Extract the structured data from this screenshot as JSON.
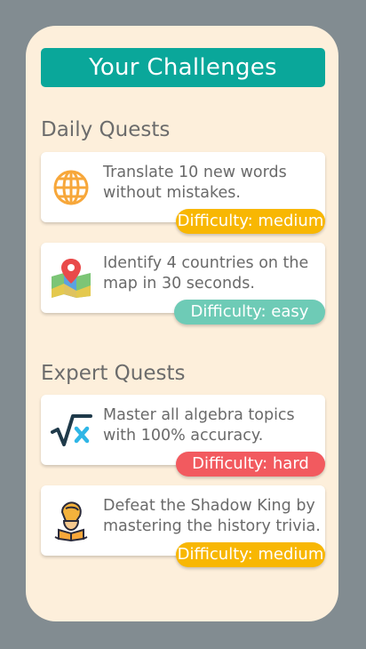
{
  "header": {
    "title": "Your Challenges"
  },
  "sections": {
    "daily": {
      "title": "Daily Quests",
      "quests": [
        {
          "text": "Translate 10 new words\nwithout mistakes.",
          "difficulty": "Difficulty: medium",
          "icon": "globe-icon",
          "badge_color": "#f8b703"
        },
        {
          "text": "Identify 4 countries on the\nmap in 30 seconds.",
          "difficulty": "Difficulty: easy",
          "icon": "map-pin-icon",
          "badge_color": "#6ecbb6"
        }
      ]
    },
    "expert": {
      "title": "Expert Quests",
      "quests": [
        {
          "text": "Master all algebra topics\nwith 100% accuracy.",
          "difficulty": "Difficulty: hard",
          "icon": "square-root-icon",
          "badge_color": "#f25a5f"
        },
        {
          "text": "Defeat the Shadow King by\nmastering the history trivia.",
          "difficulty": "Difficulty: medium",
          "icon": "knight-book-icon",
          "badge_color": "#f8b703"
        }
      ]
    }
  },
  "colors": {
    "background": "#828c91",
    "panel": "#fdefdb",
    "title_bar": "#0aa79a"
  }
}
